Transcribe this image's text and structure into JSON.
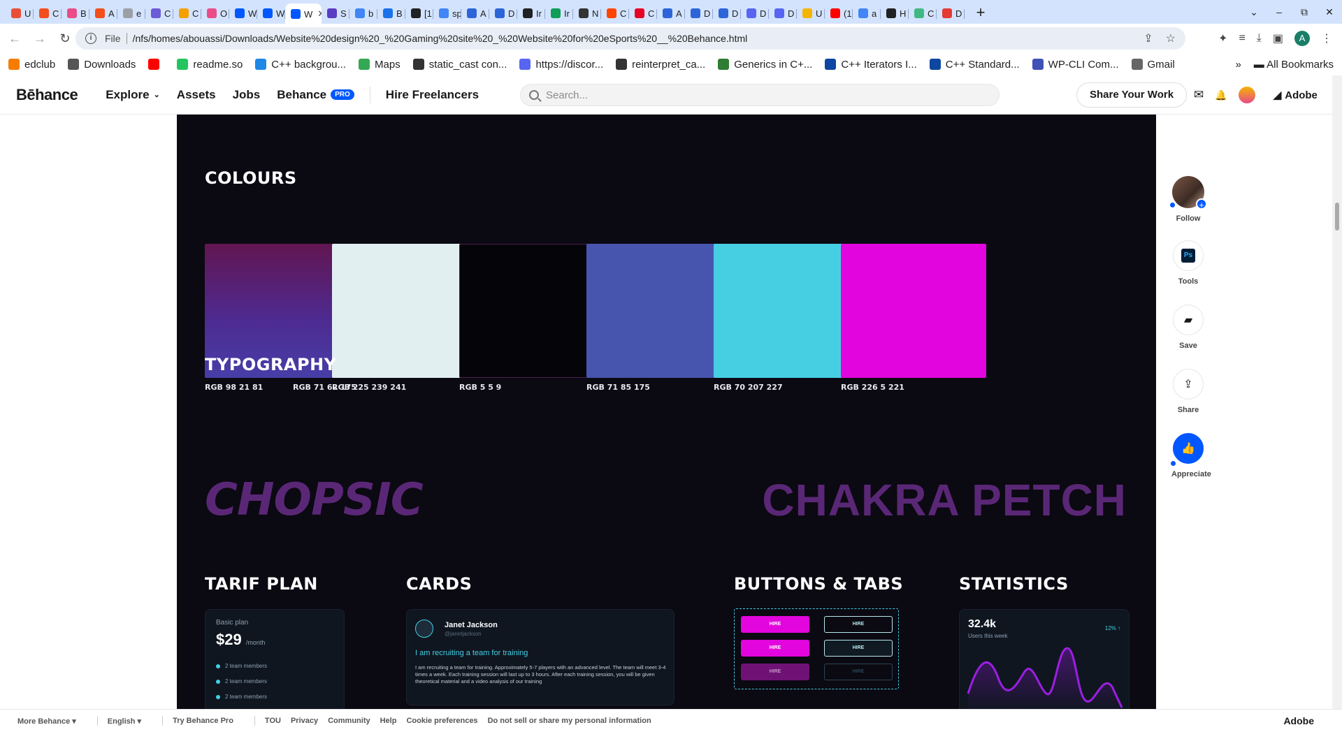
{
  "browser": {
    "tabs": [
      {
        "letter": "U",
        "color": "#e94f37"
      },
      {
        "letter": "C",
        "color": "#f24e1e"
      },
      {
        "letter": "B",
        "color": "#ea4c89"
      },
      {
        "letter": "A",
        "color": "#f24e1e"
      },
      {
        "letter": "e",
        "color": "#9aa0a6"
      },
      {
        "letter": "C",
        "color": "#6e5bd6"
      },
      {
        "letter": "C",
        "color": "#f4a100"
      },
      {
        "letter": "O",
        "color": "#ea4c89"
      },
      {
        "letter": "W",
        "color": "#0057ff"
      },
      {
        "letter": "W",
        "color": "#0057ff"
      },
      {
        "letter": "W",
        "color": "#0057ff"
      },
      {
        "letter": "S",
        "color": "#5b3cc4"
      },
      {
        "letter": "b",
        "color": "#4285f4"
      },
      {
        "letter": "B",
        "color": "#1a73e8"
      },
      {
        "letter": "[1",
        "color": "#202124"
      },
      {
        "letter": "sp",
        "color": "#4285f4"
      },
      {
        "letter": "A",
        "color": "#2d65d8"
      },
      {
        "letter": "D",
        "color": "#2d65d8"
      },
      {
        "letter": "Ir",
        "color": "#202124"
      },
      {
        "letter": "Ir",
        "color": "#0f9d58"
      },
      {
        "letter": "N",
        "color": "#333"
      },
      {
        "letter": "C",
        "color": "#ff4500"
      },
      {
        "letter": "C",
        "color": "#e60023"
      },
      {
        "letter": "A",
        "color": "#2d65d8"
      },
      {
        "letter": "D",
        "color": "#2d65d8"
      },
      {
        "letter": "D",
        "color": "#2d65d8"
      },
      {
        "letter": "D",
        "color": "#5865f2"
      },
      {
        "letter": "D",
        "color": "#5865f2"
      },
      {
        "letter": "U",
        "color": "#f4b400"
      },
      {
        "letter": "(1",
        "color": "#ff0000"
      },
      {
        "letter": "a",
        "color": "#4285f4"
      },
      {
        "letter": "H",
        "color": "#202124"
      },
      {
        "letter": "C",
        "color": "#41b883"
      },
      {
        "letter": "D",
        "color": "#e53935"
      }
    ],
    "active_tab_index": 10,
    "active_tab_title": "W",
    "close_glyph": "✕",
    "new_tab_glyph": "+",
    "window_controls": [
      "⌄",
      "–",
      "⧉",
      "✕"
    ],
    "back_glyph": "←",
    "forward_glyph": "→",
    "reload_glyph": "↻",
    "file_label": "File",
    "url": "/nfs/homes/abouassi/Downloads/Website%20design%20_%20Gaming%20site%20_%20Website%20for%20eSports%20__%20Behance.html",
    "omnibox_icons": [
      "⇪",
      "☆"
    ],
    "toolbar_icons": [
      "✦",
      "≡",
      "⤓",
      "▣"
    ],
    "profile_letter": "A",
    "bookmarks": [
      {
        "label": "edclub",
        "color": "#f57c00"
      },
      {
        "label": "Downloads",
        "color": "#555"
      },
      {
        "label": "",
        "color": "#ff0000"
      },
      {
        "label": "readme.so",
        "color": "#22c55e"
      },
      {
        "label": "C++ backgrou...",
        "color": "#1e88e5"
      },
      {
        "label": "Maps",
        "color": "#34a853"
      },
      {
        "label": "static_cast con...",
        "color": "#333"
      },
      {
        "label": "https://discor...",
        "color": "#5865f2"
      },
      {
        "label": "reinterpret_ca...",
        "color": "#333"
      },
      {
        "label": "Generics in C+...",
        "color": "#2e7d32"
      },
      {
        "label": "C++ Iterators I...",
        "color": "#0d47a1"
      },
      {
        "label": "C++ Standard...",
        "color": "#0d47a1"
      },
      {
        "label": "WP-CLI Com...",
        "color": "#3f51b5"
      },
      {
        "label": "Gmail",
        "color": "#666"
      }
    ],
    "bookmarks_more": "»",
    "all_bookmarks": "All Bookmarks"
  },
  "header": {
    "logo": "Bēhance",
    "nav": {
      "explore": "Explore",
      "assets": "Assets",
      "jobs": "Jobs",
      "behance": "Behance",
      "pro": "PRO",
      "hire": "Hire Freelancers"
    },
    "search_placeholder": "Search...",
    "share_button": "Share Your Work",
    "icons": {
      "mail": "✉",
      "bell": "🔔"
    },
    "adobe": "Adobe"
  },
  "project": {
    "colours_title": "COLOURS",
    "swatches": [
      {
        "fill": "linear-gradient(180deg,#621551 0%,#4e2a8f 55%,#473ea8 100%)",
        "rgb1": "RGB  98 21 81",
        "rgb2": "RGB  71 62 175"
      },
      {
        "fill": "#e1eff1",
        "rgb1": "RGB  225 239 241",
        "rgb2": ""
      },
      {
        "fill": "#050509",
        "rgb1": "RGB  5 5 9",
        "rgb2": ""
      },
      {
        "fill": "#4755af",
        "rgb1": "RGB  71 85 175",
        "rgb2": ""
      },
      {
        "fill": "#46cfe3",
        "rgb1": "RGB  70 207 227",
        "rgb2": ""
      },
      {
        "fill": "#e205dd",
        "rgb1": "RGB  226 5 221",
        "rgb2": ""
      }
    ],
    "typography_title": "TYPOGRAPHY",
    "font1": "CHOPSIC",
    "font2": "CHAKRA PETCH",
    "tarif_title": "TARIF PLAN",
    "tarif": {
      "label": "Basic plan",
      "price": "$29",
      "per": "/month",
      "items": [
        "2 team members",
        "2 team members",
        "2 team members"
      ]
    },
    "cards_title": "CARDS",
    "card": {
      "name": "Janet Jackson",
      "handle": "@janetjackson",
      "headline": "I am recruiting a team for training",
      "body": "I am recruiting a team for training. Approximately 5-7 players with an advanced level. The team will meet 3-4 times a week. Each training session will last up to 3 hours. After each training session, you will be given theoretical material and a video analysis of our training"
    },
    "buttons_title": "BUTTONS & TABS",
    "button_label": "HIRE",
    "stats_title": "STATISTICS",
    "stats": {
      "value": "32.4k",
      "label": "Users this week",
      "percent": "12% ↑"
    }
  },
  "rail": {
    "follow": "Follow",
    "tools": "Tools",
    "ps": "Ps",
    "save": "Save",
    "share": "Share",
    "appreciate": "Appreciate",
    "plus": "+"
  },
  "footer": {
    "more": "More Behance ▾",
    "language": "English ▾",
    "try_pro": "Try Behance Pro",
    "links": [
      "TOU",
      "Privacy",
      "Community",
      "Help",
      "Cookie preferences",
      "Do not sell or share my personal information"
    ],
    "adobe": "Adobe"
  }
}
